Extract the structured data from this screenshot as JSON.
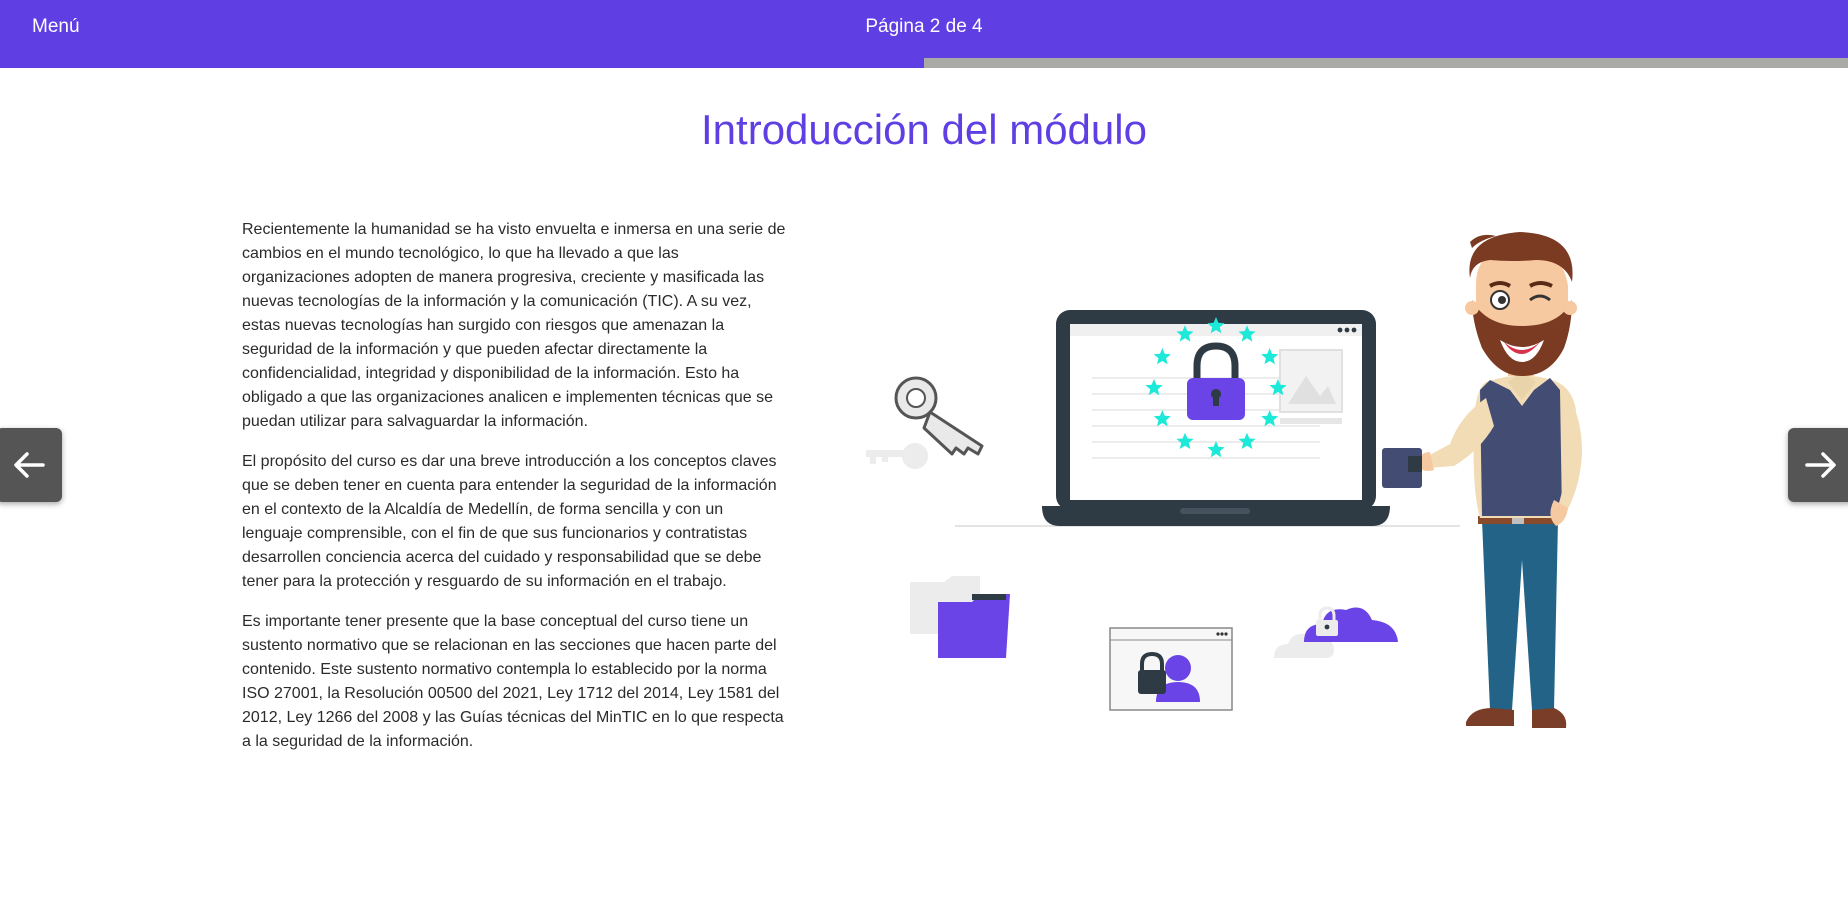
{
  "header": {
    "menu_label": "Menú",
    "page_indicator": "Página 2 de 4",
    "progress_fraction": 0.5,
    "accent_color": "#5f3fe3"
  },
  "main": {
    "title": "Introducción del módulo",
    "paragraphs": [
      "Recientemente la humanidad se ha visto envuelta e inmersa en una serie de cambios en el mundo tecnológico, lo que ha llevado a que las organizaciones adopten de manera progresiva, creciente y masificada las nuevas tecnologías de la información y la comunicación (TIC). A su vez, estas nuevas tecnologías han surgido con riesgos que amenazan la seguridad de la información y que pueden afectar directamente la confidencialidad, integridad y disponibilidad de la información. Esto ha obligado a que las organizaciones analicen e implementen técnicas que se puedan utilizar para salvaguardar la información.",
      "El propósito del curso es dar una breve introducción a los conceptos claves que se deben tener en cuenta para entender la seguridad de la información en el contexto de la Alcaldía de Medellín, de forma sencilla y con un lenguaje comprensible, con el fin de que sus funcionarios y contratistas desarrollen conciencia acerca del cuidado y responsabilidad que se debe tener para la protección y resguardo de su información en el trabajo.",
      "Es importante tener presente que la base conceptual del curso tiene un sustento normativo que se relacionan en las secciones que hacen parte del contenido. Este sustento normativo contempla lo establecido por la norma ISO 27001, la Resolución 00500 del 2021, Ley 1712 del 2014, Ley 1581 del 2012, Ley 1266 del 2008 y las Guías técnicas del MinTIC en lo que respecta a la seguridad de la información."
    ]
  },
  "navigation": {
    "prev_icon": "arrow-left-icon",
    "next_icon": "arrow-right-icon"
  },
  "illustration": {
    "icons": [
      "laptop-icon",
      "padlock-icon",
      "stars-ring-icon",
      "key-icon",
      "folder-icon",
      "user-lock-window-icon",
      "cloud-lock-icon",
      "man-character"
    ],
    "star_color": "#1de9d9"
  }
}
